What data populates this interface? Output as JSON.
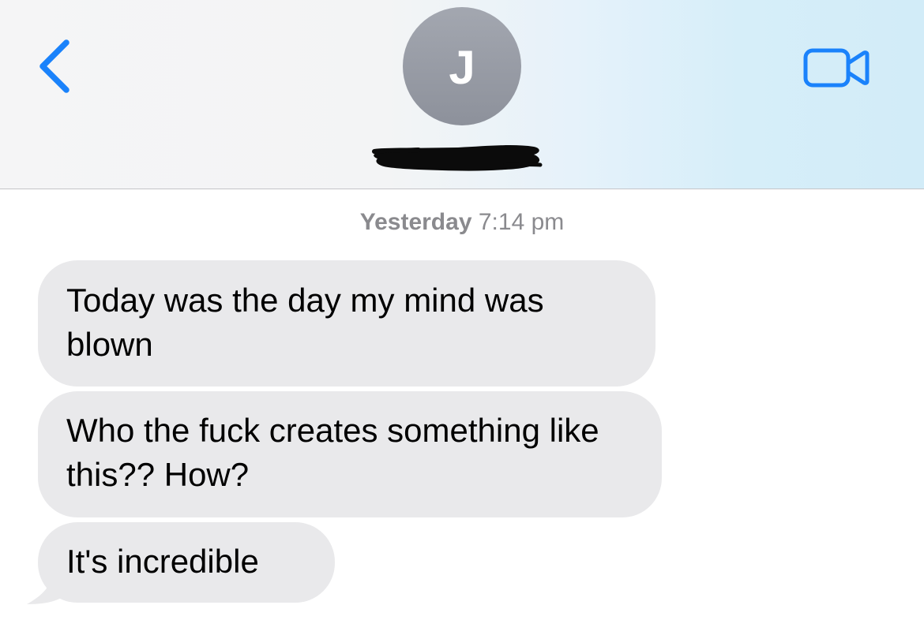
{
  "header": {
    "back_icon": "chevron-left-icon",
    "avatar_initial": "J",
    "contact_name_redacted": true,
    "video_icon": "video-camera-icon",
    "accent_color": "#1a82fb"
  },
  "thread": {
    "timestamp_day": "Yesterday",
    "timestamp_time": "7:14 pm",
    "messages": [
      {
        "direction": "incoming",
        "text": "Today was the day my mind was blown"
      },
      {
        "direction": "incoming",
        "text": "Who the fuck creates something like this?? How?"
      },
      {
        "direction": "incoming",
        "text": "It's incredible"
      }
    ],
    "incoming_bubble_color": "#e9e9eb"
  }
}
